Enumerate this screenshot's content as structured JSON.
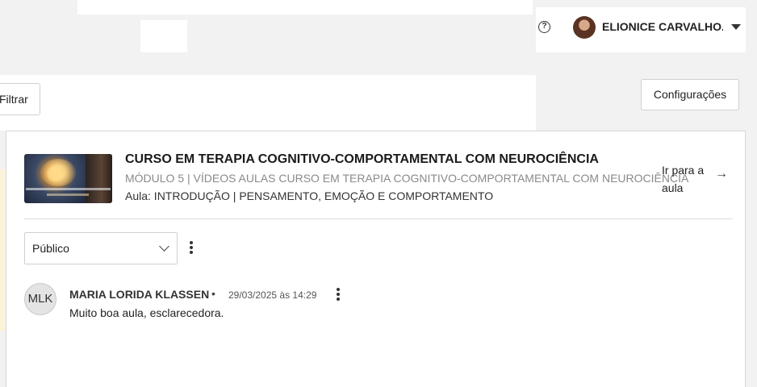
{
  "header": {
    "help_icon": "question-circle-icon",
    "user_name": "ELIONICE CARVALHO...",
    "user_menu_icon": "caret-down-icon"
  },
  "toolbar": {
    "filter_label": "Filtrar",
    "settings_label": "Configurações"
  },
  "lesson_card": {
    "course_title": "CURSO EM TERAPIA COGNITIVO-COMPORTAMENTAL COM NEUROCIÊNCIA",
    "module": "MÓDULO 5 | VÍDEOS AULAS CURSO EM TERAPIA COGNITIVO-COMPORTAMENTAL COM NEUROCIÊNCIA",
    "lesson": "Aula: INTRODUÇÃO | PENSAMENTO, EMOÇÃO E COMPORTAMENTO",
    "go_to_lesson": "Ir para a aula",
    "arrow": "→"
  },
  "comments": {
    "visibility_selected": "Público",
    "items": [
      {
        "initials": "MLK",
        "author": "MARIA LORIDA KLASSEN",
        "separator": "•",
        "date": "29/03/2025 às 14:29",
        "text": "Muito boa aula, esclarecedora."
      }
    ]
  },
  "colors": {
    "background": "#f2f2f2",
    "panel": "#ffffff",
    "muted_text": "#8a8a8a",
    "border": "#cfcfcf"
  }
}
